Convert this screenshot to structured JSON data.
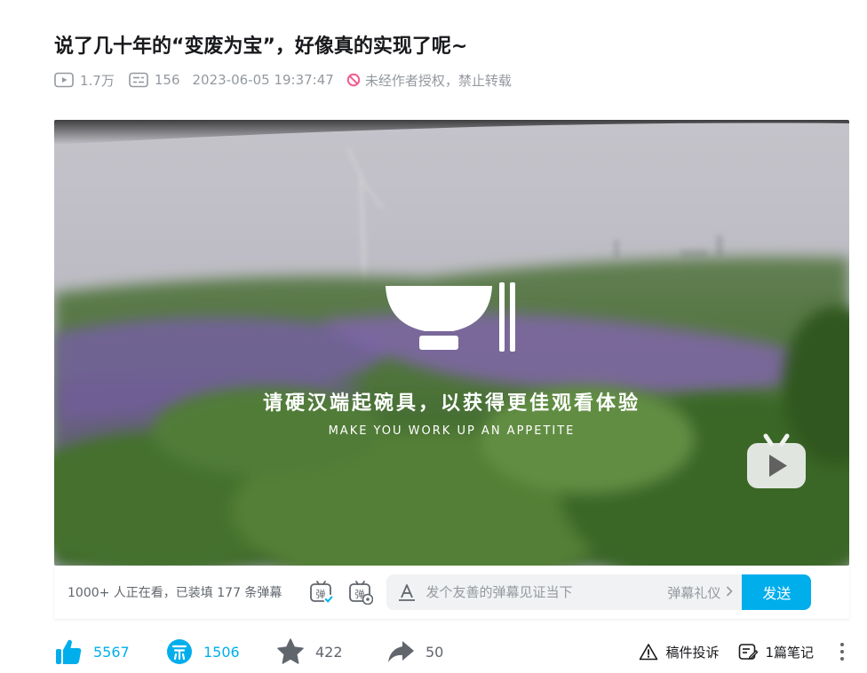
{
  "video": {
    "title": "说了几十年的“变废为宝”，好像真的实现了呢~",
    "plays": "1.7万",
    "danmaku_count": "156",
    "publish_time": "2023-06-05 19:37:47",
    "copyright_notice": "未经作者授权，禁止转载"
  },
  "player": {
    "overlay_cn": "请硬汉端起碗具，以获得更佳观看体验",
    "overlay_en": "MAKE YOU WORK UP AN APPETITE"
  },
  "danmu_bar": {
    "viewers_text": "1000+ 人正在看，已装填 177 条弹幕",
    "input_placeholder": "发个友善的弹幕见证当下",
    "etiquette_label": "弹幕礼仪",
    "send_label": "发送"
  },
  "toolbar": {
    "like_count": "5567",
    "coin_count": "1506",
    "favorite_count": "422",
    "share_count": "50",
    "report_label": "稿件投诉",
    "notes_label": "1篇笔记"
  },
  "colors": {
    "accent": "#00aeec",
    "meta_gray": "#9499a0",
    "forbid_red": "#f25d8e"
  },
  "icons": [
    "play-count-icon",
    "danmaku-count-icon",
    "no-repost-icon",
    "danmaku-toggle-icon",
    "danmaku-settings-icon",
    "text-style-icon",
    "chevron-right-icon",
    "thumb-up-icon",
    "coin-icon",
    "star-icon",
    "share-arrow-icon",
    "warning-icon",
    "notes-icon",
    "more-dots-icon",
    "bilibili-tv-icon",
    "bowl-chopsticks-icon"
  ]
}
